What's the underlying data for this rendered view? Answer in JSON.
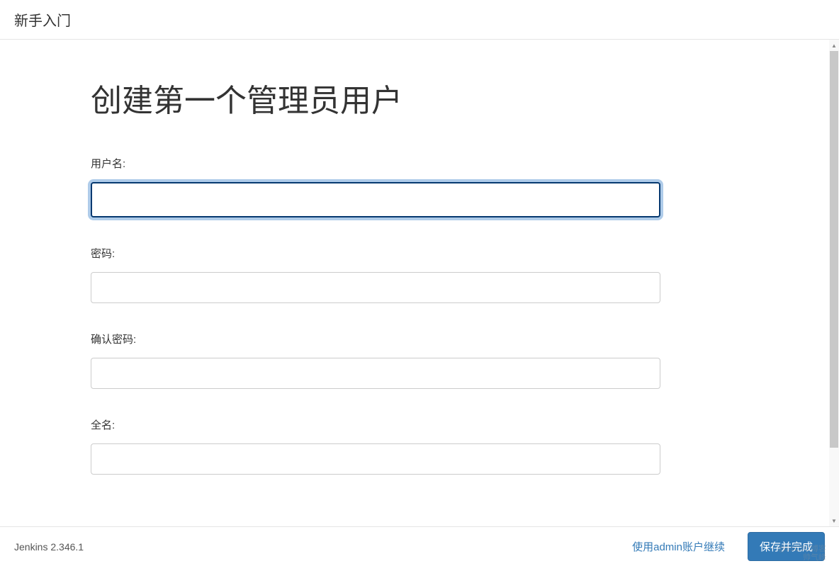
{
  "header": {
    "title": "新手入门"
  },
  "main": {
    "title": "创建第一个管理员用户",
    "fields": {
      "username": {
        "label": "用户名:",
        "value": ""
      },
      "password": {
        "label": "密码:",
        "value": ""
      },
      "confirm_password": {
        "label": "确认密码:",
        "value": ""
      },
      "fullname": {
        "label": "全名:",
        "value": ""
      }
    }
  },
  "footer": {
    "version": "Jenkins 2.346.1",
    "continue_as_admin": "使用admin账户继续",
    "save_and_finish": "保存并完成"
  }
}
